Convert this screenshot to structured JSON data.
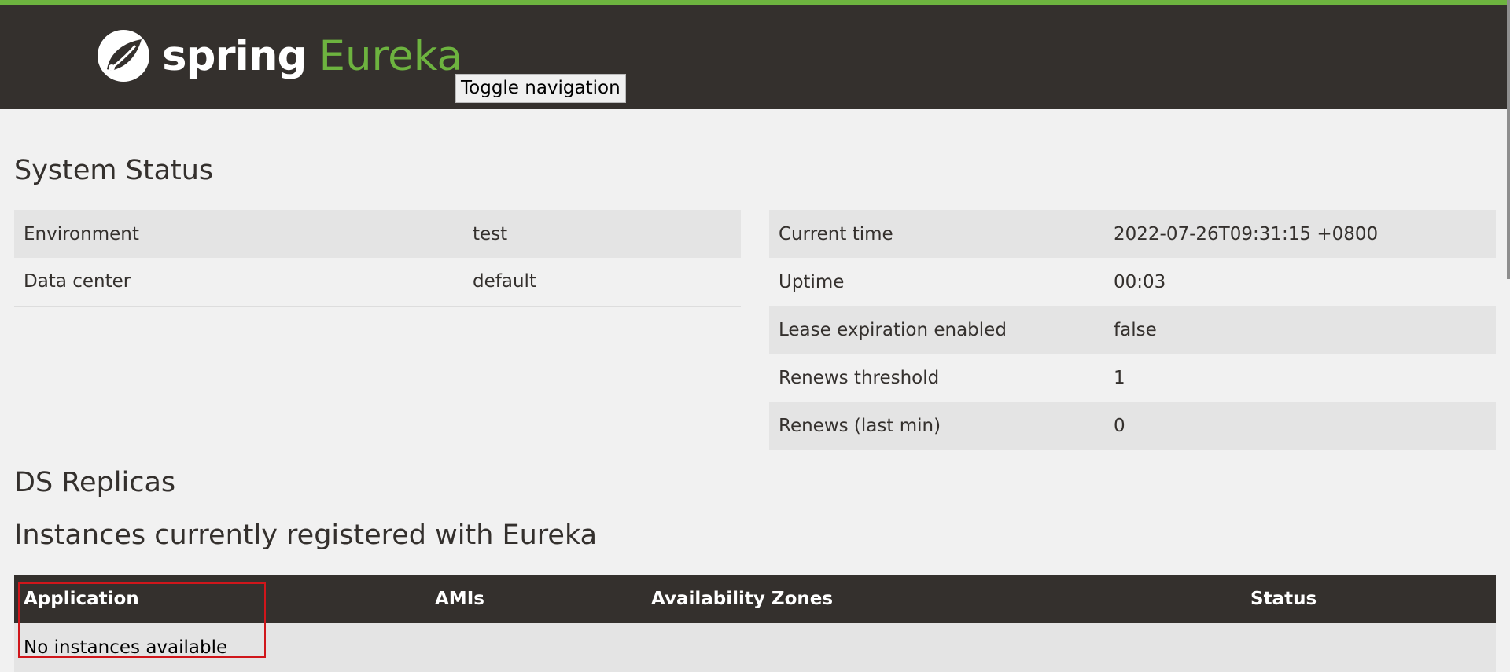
{
  "header": {
    "logo_spring": "spring",
    "logo_eureka": "Eureka",
    "toggle_nav": "Toggle navigation",
    "colors": {
      "bar": "#34302d",
      "accent": "#6db33f"
    }
  },
  "system_status": {
    "title": "System Status",
    "left": [
      {
        "key": "Environment",
        "value": "test"
      },
      {
        "key": "Data center",
        "value": "default"
      }
    ],
    "right": [
      {
        "key": "Current time",
        "value": "2022-07-26T09:31:15 +0800"
      },
      {
        "key": "Uptime",
        "value": "00:03"
      },
      {
        "key": "Lease expiration enabled",
        "value": "false"
      },
      {
        "key": "Renews threshold",
        "value": "1"
      },
      {
        "key": "Renews (last min)",
        "value": "0"
      }
    ]
  },
  "ds_replicas": {
    "title": "DS Replicas"
  },
  "instances": {
    "title": "Instances currently registered with Eureka",
    "columns": [
      "Application",
      "AMIs",
      "Availability Zones",
      "Status"
    ],
    "empty_message": "No instances available"
  }
}
